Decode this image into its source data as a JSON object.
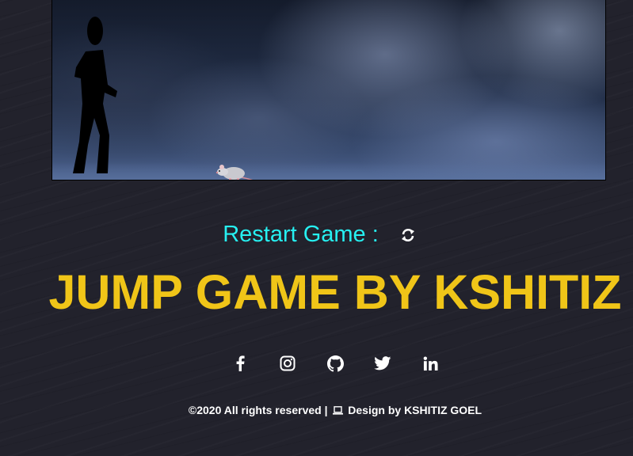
{
  "game": {
    "player_icon": "stick-figure-walking",
    "obstacle_icon": "rat"
  },
  "controls": {
    "restart_label": "Restart Game :",
    "restart_icon": "refresh-icon"
  },
  "title": "JUMP GAME BY KSHITIZ",
  "social": [
    {
      "name": "facebook",
      "icon": "facebook-icon"
    },
    {
      "name": "instagram",
      "icon": "instagram-icon"
    },
    {
      "name": "github",
      "icon": "github-icon"
    },
    {
      "name": "twitter",
      "icon": "twitter-icon"
    },
    {
      "name": "linkedin",
      "icon": "linkedin-icon"
    }
  ],
  "footer": {
    "copyright": "©2020 All rights reserved |",
    "design_credit": "Design by KSHITIZ GOEL"
  },
  "colors": {
    "background": "#22222c",
    "restart_text": "#26f0f1",
    "title": "#f0c518",
    "footer_text": "#ffffff"
  }
}
